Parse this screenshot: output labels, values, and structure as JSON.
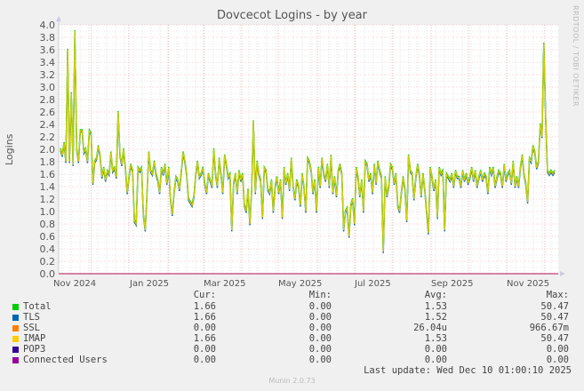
{
  "chart_data": {
    "type": "line",
    "title": "Dovcecot Logins - by year",
    "ylabel": "Logins",
    "xlabel": "",
    "ylim": [
      0,
      4.0
    ],
    "yticks": [
      "0.0",
      "0.2",
      "0.4",
      "0.6",
      "0.8",
      "1.0",
      "1.2",
      "1.4",
      "1.6",
      "1.8",
      "2.0",
      "2.2",
      "2.4",
      "2.6",
      "2.8",
      "3.0",
      "3.2",
      "3.4",
      "3.6",
      "3.8",
      "4.0"
    ],
    "xticks": [
      "Nov 2024",
      "Jan 2025",
      "Mar 2025",
      "May 2025",
      "Jul 2025",
      "Sep 2025",
      "Nov 2025"
    ],
    "x_range": [
      "2024-10-29",
      "2025-12-10"
    ],
    "grid": true,
    "series": [
      {
        "name": "Total",
        "color": "#00cc00"
      },
      {
        "name": "TLS",
        "color": "#0066b3"
      },
      {
        "name": "SSL",
        "color": "#ff8000"
      },
      {
        "name": "IMAP",
        "color": "#ffcc00"
      },
      {
        "name": "POP3",
        "color": "#330099"
      },
      {
        "name": "Connected Users",
        "color": "#990099"
      }
    ],
    "imap_values": [
      2.0,
      1.9,
      2.1,
      1.8,
      3.6,
      1.8,
      2.9,
      1.75,
      3.9,
      2.0,
      1.8,
      2.3,
      2.3,
      1.95,
      2.0,
      1.8,
      2.3,
      2.25,
      1.45,
      1.8,
      1.85,
      2.05,
      1.9,
      1.55,
      1.7,
      1.5,
      1.65,
      1.6,
      1.95,
      1.65,
      1.7,
      1.55,
      2.6,
      1.9,
      1.75,
      2.0,
      1.7,
      1.3,
      1.55,
      1.75,
      1.65,
      0.85,
      0.8,
      1.7,
      1.65,
      1.7,
      0.95,
      0.7,
      1.3,
      1.95,
      1.65,
      1.6,
      1.8,
      1.6,
      1.5,
      1.3,
      1.7,
      1.6,
      1.75,
      1.45,
      1.7,
      1.2,
      0.95,
      1.3,
      1.55,
      1.5,
      1.35,
      1.65,
      1.95,
      1.8,
      1.6,
      1.2,
      1.15,
      1.1,
      1.25,
      1.6,
      1.8,
      1.55,
      1.6,
      1.7,
      1.45,
      1.3,
      1.6,
      1.5,
      1.4,
      2.0,
      1.6,
      1.4,
      1.85,
      1.6,
      1.3,
      1.9,
      1.75,
      1.55,
      1.6,
      0.7,
      1.45,
      1.6,
      1.3,
      1.65,
      1.5,
      1.6,
      1.1,
      1.0,
      1.35,
      0.8,
      1.35,
      2.45,
      1.3,
      1.8,
      1.6,
      1.5,
      0.9,
      1.7,
      1.65,
      1.35,
      1.3,
      1.5,
      1.0,
      1.4,
      1.55,
      1.3,
      1.5,
      0.9,
      1.7,
      1.45,
      1.6,
      1.35,
      1.85,
      1.4,
      1.2,
      1.5,
      1.4,
      1.1,
      1.6,
      1.4,
      1.0,
      1.85,
      1.8,
      1.65,
      1.3,
      1.5,
      1.0,
      1.7,
      1.4,
      1.85,
      1.6,
      1.5,
      1.75,
      1.4,
      1.9,
      1.3,
      1.55,
      1.25,
      1.65,
      1.75,
      1.6,
      0.7,
      1.0,
      1.05,
      0.6,
      1.1,
      1.2,
      0.8,
      1.7,
      1.55,
      1.25,
      1.5,
      1.0,
      1.8,
      1.75,
      1.5,
      1.6,
      1.3,
      1.75,
      1.45,
      1.8,
      1.65,
      1.55,
      0.35,
      1.55,
      1.25,
      1.4,
      1.75,
      1.7,
      1.45,
      1.6,
      1.1,
      1.0,
      1.3,
      1.55,
      1.35,
      0.85,
      1.9,
      1.65,
      1.6,
      1.2,
      1.55,
      1.75,
      1.6,
      1.25,
      1.6,
      1.35,
      1.0,
      0.65,
      1.7,
      1.55,
      1.35,
      1.5,
      0.9,
      1.7,
      1.6,
      1.65,
      0.7,
      1.6,
      1.55,
      1.5,
      1.6,
      1.4,
      1.65,
      1.55,
      1.55,
      1.4,
      1.65,
      1.5,
      1.6,
      1.45,
      1.55,
      1.7,
      1.5,
      1.65,
      1.4,
      1.55,
      1.65,
      1.5,
      1.6,
      1.55,
      1.3,
      1.7,
      1.6,
      1.7,
      1.4,
      1.55,
      1.65,
      1.6,
      1.4,
      1.75,
      1.5,
      1.6,
      1.65,
      1.45,
      1.8,
      1.4,
      1.55,
      1.4,
      1.7,
      1.9,
      1.6,
      1.45,
      1.15,
      1.85,
      1.8,
      2.05,
      1.95,
      1.7,
      1.8,
      2.4,
      2.2,
      3.7,
      2.5,
      1.65,
      1.6,
      1.65,
      1.6,
      1.65
    ]
  },
  "legend": {
    "headers": {
      "cur": "Cur:",
      "min": "Min:",
      "avg": "Avg:",
      "max": "Max:"
    },
    "rows": [
      {
        "name": "Total",
        "cur": "1.66",
        "min": "0.00",
        "avg": "1.53",
        "max": "50.47"
      },
      {
        "name": "TLS",
        "cur": "1.66",
        "min": "0.00",
        "avg": "1.52",
        "max": "50.47"
      },
      {
        "name": "SSL",
        "cur": "0.00",
        "min": "0.00",
        "avg": "26.04u",
        "max": "966.67m"
      },
      {
        "name": "IMAP",
        "cur": "1.66",
        "min": "0.00",
        "avg": "1.53",
        "max": "50.47"
      },
      {
        "name": "POP3",
        "cur": "0.00",
        "min": "0.00",
        "avg": "0.00",
        "max": "0.00"
      },
      {
        "name": "Connected Users",
        "cur": "0.00",
        "min": "0.00",
        "avg": "0.00",
        "max": "0.00"
      }
    ]
  },
  "last_update": "Last update: Wed Dec 10 01:00:10 2025",
  "credit": "RRDTOOL / TOBI OETIKER",
  "footer": "Munin 2.0.73"
}
